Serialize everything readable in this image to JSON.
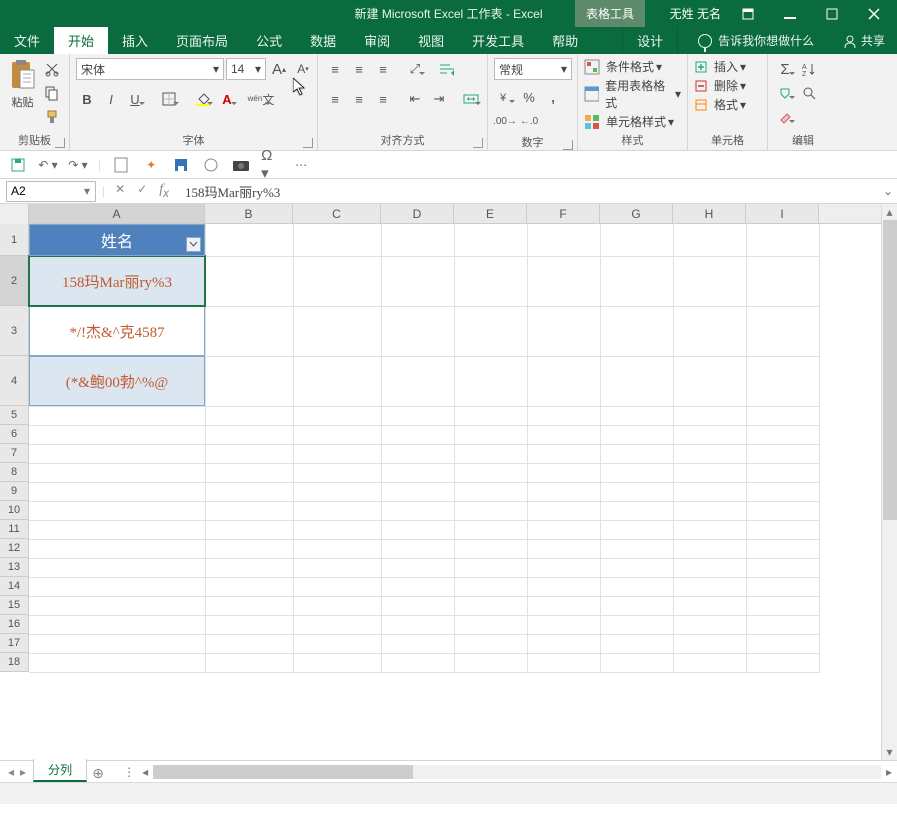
{
  "titlebar": {
    "title": "新建 Microsoft Excel 工作表  -  Excel",
    "context_tab": "表格工具",
    "user": "无姓 无名"
  },
  "tabs": [
    "文件",
    "开始",
    "插入",
    "页面布局",
    "公式",
    "数据",
    "审阅",
    "视图",
    "开发工具",
    "帮助",
    "设计"
  ],
  "tellme": "告诉我你想做什么",
  "share": "共享",
  "ribbon": {
    "clipboard": {
      "paste": "粘贴",
      "label": "剪贴板"
    },
    "font": {
      "name": "宋体",
      "size": "14",
      "label": "字体"
    },
    "alignment": {
      "label": "对齐方式"
    },
    "number": {
      "format": "常规",
      "label": "数字"
    },
    "styles": {
      "cond": "条件格式",
      "tfmt": "套用表格格式",
      "cell": "单元格样式",
      "label": "样式"
    },
    "cells": {
      "insert": "插入",
      "delete": "删除",
      "format": "格式",
      "label": "单元格"
    },
    "editing": {
      "label": "编辑"
    }
  },
  "wen": "wén",
  "namebox": "A2",
  "formula": "158玛Mar丽ry%3",
  "columns": [
    "A",
    "B",
    "C",
    "D",
    "E",
    "F",
    "G",
    "H",
    "I"
  ],
  "row_numbers": [
    "1",
    "2",
    "3",
    "4",
    "5",
    "6",
    "7",
    "8",
    "9",
    "10",
    "11",
    "12",
    "13",
    "14",
    "15",
    "16",
    "17",
    "18"
  ],
  "cells": {
    "A1": "姓名",
    "A2": "158玛Mar丽ry%3",
    "A3": "*/!杰&^克4587",
    "A4": "(*&鲍00勃^%@"
  },
  "sheet": {
    "active": "分列"
  }
}
